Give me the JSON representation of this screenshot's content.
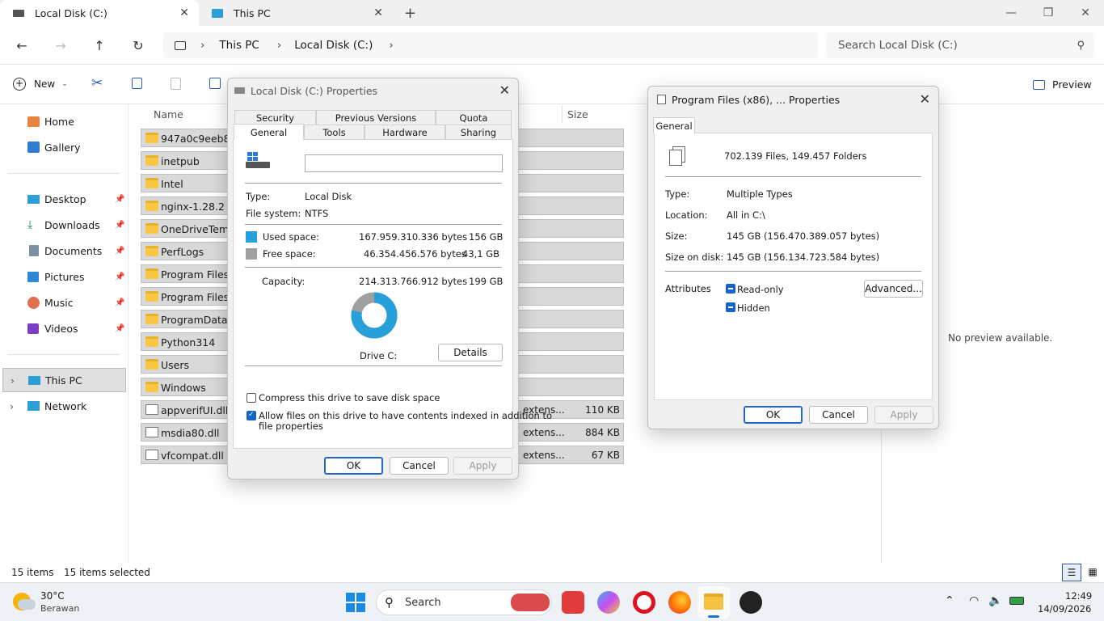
{
  "tabs": [
    {
      "title": "Local Disk (C:)",
      "active": true
    },
    {
      "title": "This PC",
      "active": false
    }
  ],
  "window_controls": {
    "minimize": "—",
    "restore": "❐",
    "close": "✕"
  },
  "address": {
    "segments": [
      "This PC",
      "Local Disk (C:)"
    ]
  },
  "search": {
    "placeholder": "Search Local Disk (C:)"
  },
  "commandbar": {
    "new_label": "New",
    "preview_label": "Preview"
  },
  "sidebar": {
    "quick": [
      {
        "label": "Home"
      },
      {
        "label": "Gallery"
      }
    ],
    "pinned": [
      {
        "label": "Desktop"
      },
      {
        "label": "Downloads"
      },
      {
        "label": "Documents"
      },
      {
        "label": "Pictures"
      },
      {
        "label": "Music"
      },
      {
        "label": "Videos"
      }
    ],
    "locations": [
      {
        "label": "This PC"
      },
      {
        "label": "Network"
      }
    ]
  },
  "filelist": {
    "headers": {
      "name": "Name",
      "size": "Size"
    },
    "rows": [
      {
        "name": "947a0c9eeb8ea3",
        "type": "",
        "size": "",
        "kind": "folder"
      },
      {
        "name": "inetpub",
        "type": "",
        "size": "",
        "kind": "folder"
      },
      {
        "name": "Intel",
        "type": "",
        "size": "",
        "kind": "folder"
      },
      {
        "name": "nginx-1.28.2",
        "type": "",
        "size": "",
        "kind": "folder"
      },
      {
        "name": "OneDriveTemp",
        "type": "",
        "size": "",
        "kind": "folder"
      },
      {
        "name": "PerfLogs",
        "type": "",
        "size": "",
        "kind": "folder"
      },
      {
        "name": "Program Files",
        "type": "",
        "size": "",
        "kind": "folder"
      },
      {
        "name": "Program Files (x",
        "type": "",
        "size": "",
        "kind": "folder"
      },
      {
        "name": "ProgramData",
        "type": "",
        "size": "",
        "kind": "folder"
      },
      {
        "name": "Python314",
        "type": "",
        "size": "",
        "kind": "folder"
      },
      {
        "name": "Users",
        "type": "",
        "size": "",
        "kind": "folder"
      },
      {
        "name": "Windows",
        "type": "",
        "size": "",
        "kind": "folder"
      },
      {
        "name": "appverifUI.dll",
        "type": "extens...",
        "size": "110 KB",
        "kind": "dll"
      },
      {
        "name": "msdia80.dll",
        "type": "extens...",
        "size": "884 KB",
        "kind": "dll"
      },
      {
        "name": "vfcompat.dll",
        "type": "extens...",
        "size": "67 KB",
        "kind": "dll"
      }
    ]
  },
  "preview": {
    "empty_text": "No preview available."
  },
  "status": {
    "items_count": "15 items",
    "selected_count": "15 items selected"
  },
  "drive_dialog": {
    "title": "Local Disk (C:) Properties",
    "tabs_row1": [
      "Security",
      "Previous Versions",
      "Quota"
    ],
    "tabs_row2": [
      "General",
      "Tools",
      "Hardware",
      "Sharing"
    ],
    "type_label": "Type:",
    "type_value": "Local Disk",
    "fs_label": "File system:",
    "fs_value": "NTFS",
    "used_label": "Used space:",
    "used_bytes": "167.959.310.336 bytes",
    "used_gb": "156 GB",
    "free_label": "Free space:",
    "free_bytes": "46.354.456.576 bytes",
    "free_gb": "43,1 GB",
    "capacity_label": "Capacity:",
    "capacity_bytes": "214.313.766.912 bytes",
    "capacity_gb": "199 GB",
    "used_fraction": 0.784,
    "used_color": "#26a0da",
    "free_color": "#a0a0a0",
    "drive_label": "Drive C:",
    "details_button": "Details",
    "compress_label": "Compress this drive to save disk space",
    "index_label_1": "Allow files on this drive to have contents indexed in addition to",
    "index_label_2": "file properties",
    "ok": "OK",
    "cancel": "Cancel",
    "apply": "Apply"
  },
  "folder_dialog": {
    "title": "Program Files (x86), ... Properties",
    "tab": "General",
    "summary": "702.139 Files, 149.457 Folders",
    "type_label": "Type:",
    "type_value": "Multiple Types",
    "location_label": "Location:",
    "location_value": "All in C:\\",
    "size_label": "Size:",
    "size_value": "145 GB (156.470.389.057 bytes)",
    "sod_label": "Size on disk:",
    "sod_value": "145 GB (156.134.723.584 bytes)",
    "attributes_label": "Attributes",
    "readonly_label": "Read-only",
    "hidden_label": "Hidden",
    "advanced_button": "Advanced...",
    "ok": "OK",
    "cancel": "Cancel",
    "apply": "Apply"
  },
  "taskbar": {
    "weather_temp": "30°C",
    "weather_desc": "Berawan",
    "search_label": "Search",
    "time": "12:49",
    "date": "14/09/2026"
  }
}
